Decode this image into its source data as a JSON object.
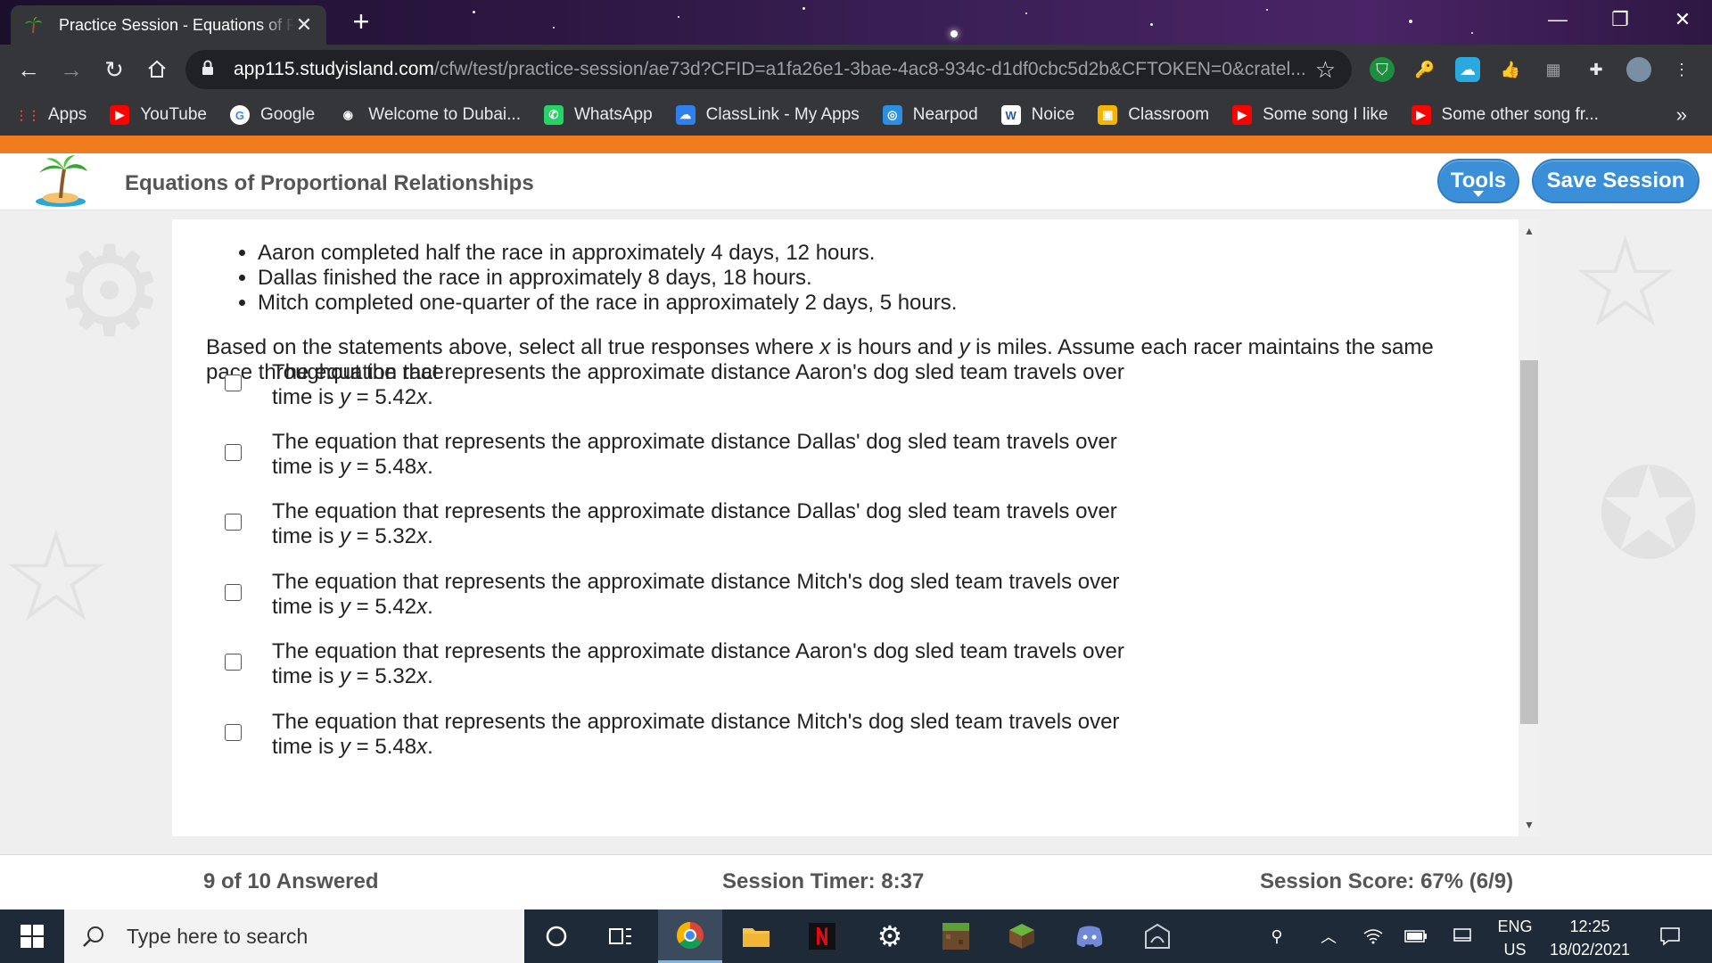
{
  "browser": {
    "tab_title": "Practice Session - Equations of Pr",
    "url_host": "app115.studyisland.com",
    "url_path": "/cfw/test/practice-session/ae73d?CFID=a1fa26e1-3bae-4ac8-934c-d1df0cbc5d2b&CFTOKEN=0&cratel...",
    "bookmarks": [
      {
        "label": "Apps",
        "icon": "apps-grid-icon",
        "color": "#ea4335"
      },
      {
        "label": "YouTube",
        "icon": "youtube-icon",
        "color": "#ff0000"
      },
      {
        "label": "Google",
        "icon": "google-icon",
        "color": "#ffffff"
      },
      {
        "label": "Welcome to Dubai...",
        "icon": "globe-icon",
        "color": "#ffffff"
      },
      {
        "label": "WhatsApp",
        "icon": "whatsapp-icon",
        "color": "#25d366"
      },
      {
        "label": "ClassLink - My Apps",
        "icon": "classlink-icon",
        "color": "#2f80ed"
      },
      {
        "label": "Nearpod",
        "icon": "nearpod-icon",
        "color": "#2b8fe3"
      },
      {
        "label": "Noice",
        "icon": "word-icon",
        "color": "#ffffff"
      },
      {
        "label": "Classroom",
        "icon": "classroom-icon",
        "color": "#f4b400"
      },
      {
        "label": "Some song I like",
        "icon": "youtube-icon",
        "color": "#ff0000"
      },
      {
        "label": "Some other song fr...",
        "icon": "youtube-icon",
        "color": "#ff0000"
      }
    ],
    "more": "»"
  },
  "header": {
    "title": "Equations of Proportional Relationships",
    "tools_label": "Tools",
    "save_label": "Save Session"
  },
  "question": {
    "facts": [
      "Aaron completed half the race in approximately 4 days, 12 hours.",
      "Dallas finished the race in approximately 8 days, 18 hours.",
      "Mitch completed one-quarter of the race in approximately 2 days, 5 hours."
    ],
    "prompt_parts": {
      "a": "Based on the statements above, select all true responses where ",
      "x": "x",
      "b": " is hours and ",
      "y": "y",
      "c": " is miles. Assume each racer maintains the same pace throughout the race."
    },
    "choices": [
      {
        "line1": "The equation that represents the approximate distance Aaron's dog sled team travels over",
        "pre": "time is ",
        "y": "y",
        "eq": " = 5.42",
        "x": "x",
        "end": ".",
        "checked": false
      },
      {
        "line1": "The equation that represents the approximate distance Dallas' dog sled team travels over",
        "pre": "time is ",
        "y": "y",
        "eq": " = 5.48",
        "x": "x",
        "end": ".",
        "checked": false
      },
      {
        "line1": "The equation that represents the approximate distance Dallas' dog sled team travels over",
        "pre": "time is ",
        "y": "y",
        "eq": " = 5.32",
        "x": "x",
        "end": ".",
        "checked": false
      },
      {
        "line1": "The equation that represents the approximate distance Mitch's dog sled team travels over",
        "pre": "time is ",
        "y": "y",
        "eq": " = 5.42",
        "x": "x",
        "end": ".",
        "checked": false
      },
      {
        "line1": "The equation that represents the approximate distance Aaron's dog sled team travels over",
        "pre": "time is ",
        "y": "y",
        "eq": " = 5.32",
        "x": "x",
        "end": ".",
        "checked": false
      },
      {
        "line1": "The equation that represents the approximate distance Mitch's dog sled team travels over",
        "pre": "time is ",
        "y": "y",
        "eq": " = 5.48",
        "x": "x",
        "end": ".",
        "checked": false
      }
    ]
  },
  "footer": {
    "answered": "9 of 10 Answered",
    "timer": "Session Timer: 8:37",
    "score": "Session Score: 67% (6/9)"
  },
  "taskbar": {
    "search_placeholder": "Type here to search",
    "lang_top": "ENG",
    "lang_bottom": "US",
    "time": "12:25",
    "date": "18/02/2021"
  },
  "colors": {
    "accent_orange": "#f07c1e",
    "button_blue": "#3a8fd8",
    "taskbar": "#1f2a38"
  }
}
